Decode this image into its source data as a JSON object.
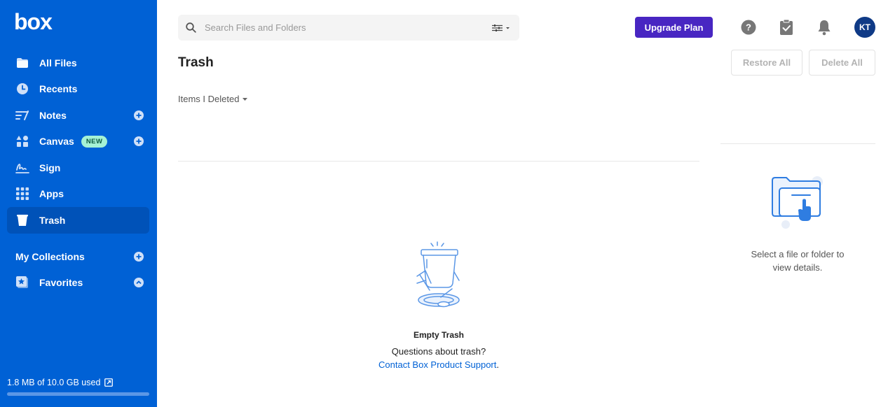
{
  "brand": {
    "logo_text": "box"
  },
  "sidebar": {
    "items": [
      {
        "label": "All Files",
        "icon": "folder-icon"
      },
      {
        "label": "Recents",
        "icon": "clock-icon"
      },
      {
        "label": "Notes",
        "icon": "notes-icon"
      },
      {
        "label": "Canvas",
        "icon": "canvas-icon",
        "badge": "NEW"
      },
      {
        "label": "Sign",
        "icon": "signature-icon"
      },
      {
        "label": "Apps",
        "icon": "grid-icon"
      },
      {
        "label": "Trash",
        "icon": "trash-icon",
        "active": true
      }
    ],
    "collections_title": "My Collections",
    "favorites_label": "Favorites",
    "storage_text": "1.8 MB of 10.0 GB used",
    "storage_used_fraction": 0.0002
  },
  "header": {
    "search_placeholder": "Search Files and Folders",
    "upgrade_label": "Upgrade Plan",
    "avatar_initials": "KT"
  },
  "main": {
    "title": "Trash",
    "restore_all_label": "Restore All",
    "delete_all_label": "Delete All",
    "filter_label": "Items I Deleted",
    "empty_title": "Empty Trash",
    "empty_question": "Questions about trash?",
    "empty_link": "Contact Box Product Support",
    "empty_link_suffix": "."
  },
  "details": {
    "text": "Select a file or folder to view details."
  },
  "colors": {
    "sidebar_bg": "#0061d5",
    "upgrade_bg": "#4826c2",
    "link": "#0061d5",
    "avatar_bg": "#0f3a86"
  }
}
